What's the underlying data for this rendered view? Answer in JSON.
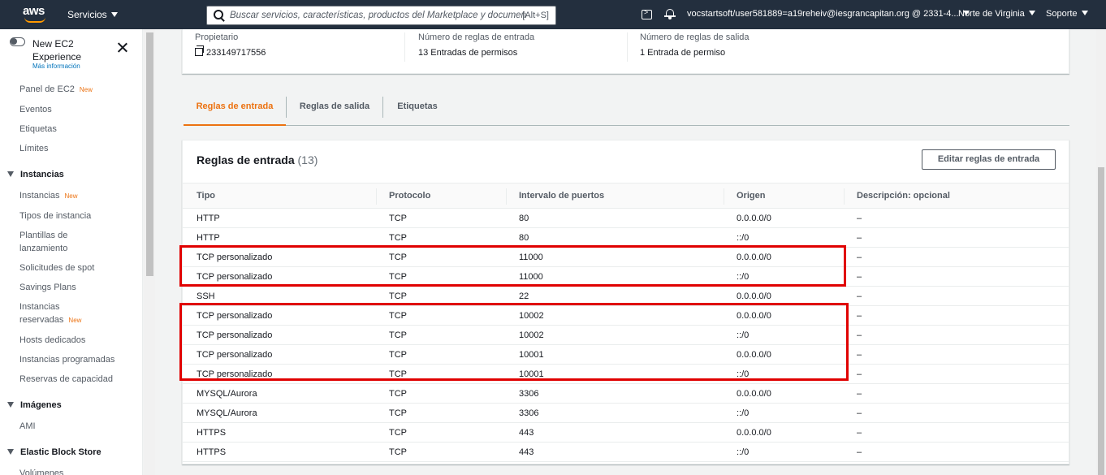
{
  "topnav": {
    "logo": "aws",
    "services_label": "Servicios",
    "search_placeholder": "Buscar servicios, características, productos del Marketplace y documen",
    "search_shortcut": "[Alt+S]",
    "user": "vocstartsoft/user581889=a19reheiv@iesgrancapitan.org @ 2331-4...",
    "region": "Norte de Virginia",
    "support": "Soporte"
  },
  "sidebar": {
    "experience_title": "New EC2 Experience",
    "experience_more": "Más información",
    "new_badge": "New",
    "top_items": [
      "Panel de EC2",
      "Eventos",
      "Etiquetas",
      "Límites"
    ],
    "sections": [
      {
        "title": "Instancias",
        "items": [
          "Instancias",
          "Tipos de instancia",
          "Plantillas de lanzamiento",
          "Solicitudes de spot",
          "Savings Plans",
          "Instancias reservadas",
          "Hosts dedicados",
          "Instancias programadas",
          "Reservas de capacidad"
        ]
      },
      {
        "title": "Imágenes",
        "items": [
          "AMI"
        ]
      },
      {
        "title": "Elastic Block Store",
        "items": [
          "Volúmenes"
        ]
      }
    ]
  },
  "summary": {
    "owner_label": "Propietario",
    "owner_value": "233149717556",
    "inbound_label": "Número de reglas de entrada",
    "inbound_value": "13 Entradas de permisos",
    "outbound_label": "Número de reglas de salida",
    "outbound_value": "1 Entrada de permiso"
  },
  "tabs": [
    "Reglas de entrada",
    "Reglas de salida",
    "Etiquetas"
  ],
  "rules": {
    "title": "Reglas de entrada",
    "count": "(13)",
    "edit_button": "Editar reglas de entrada",
    "columns": [
      "Tipo",
      "Protocolo",
      "Intervalo de puertos",
      "Origen",
      "Descripción: opcional"
    ],
    "rows": [
      [
        "HTTP",
        "TCP",
        "80",
        "0.0.0.0/0",
        "–"
      ],
      [
        "HTTP",
        "TCP",
        "80",
        "::/0",
        "–"
      ],
      [
        "TCP personalizado",
        "TCP",
        "11000",
        "0.0.0.0/0",
        "–"
      ],
      [
        "TCP personalizado",
        "TCP",
        "11000",
        "::/0",
        "–"
      ],
      [
        "SSH",
        "TCP",
        "22",
        "0.0.0.0/0",
        "–"
      ],
      [
        "TCP personalizado",
        "TCP",
        "10002",
        "0.0.0.0/0",
        "–"
      ],
      [
        "TCP personalizado",
        "TCP",
        "10002",
        "::/0",
        "–"
      ],
      [
        "TCP personalizado",
        "TCP",
        "10001",
        "0.0.0.0/0",
        "–"
      ],
      [
        "TCP personalizado",
        "TCP",
        "10001",
        "::/0",
        "–"
      ],
      [
        "MYSQL/Aurora",
        "TCP",
        "3306",
        "0.0.0.0/0",
        "–"
      ],
      [
        "MYSQL/Aurora",
        "TCP",
        "3306",
        "::/0",
        "–"
      ],
      [
        "HTTPS",
        "TCP",
        "443",
        "0.0.0.0/0",
        "–"
      ],
      [
        "HTTPS",
        "TCP",
        "443",
        "::/0",
        "–"
      ]
    ]
  },
  "colors": {
    "nav_bg": "#232f3e",
    "accent": "#ec7211",
    "highlight": "#e00000"
  }
}
